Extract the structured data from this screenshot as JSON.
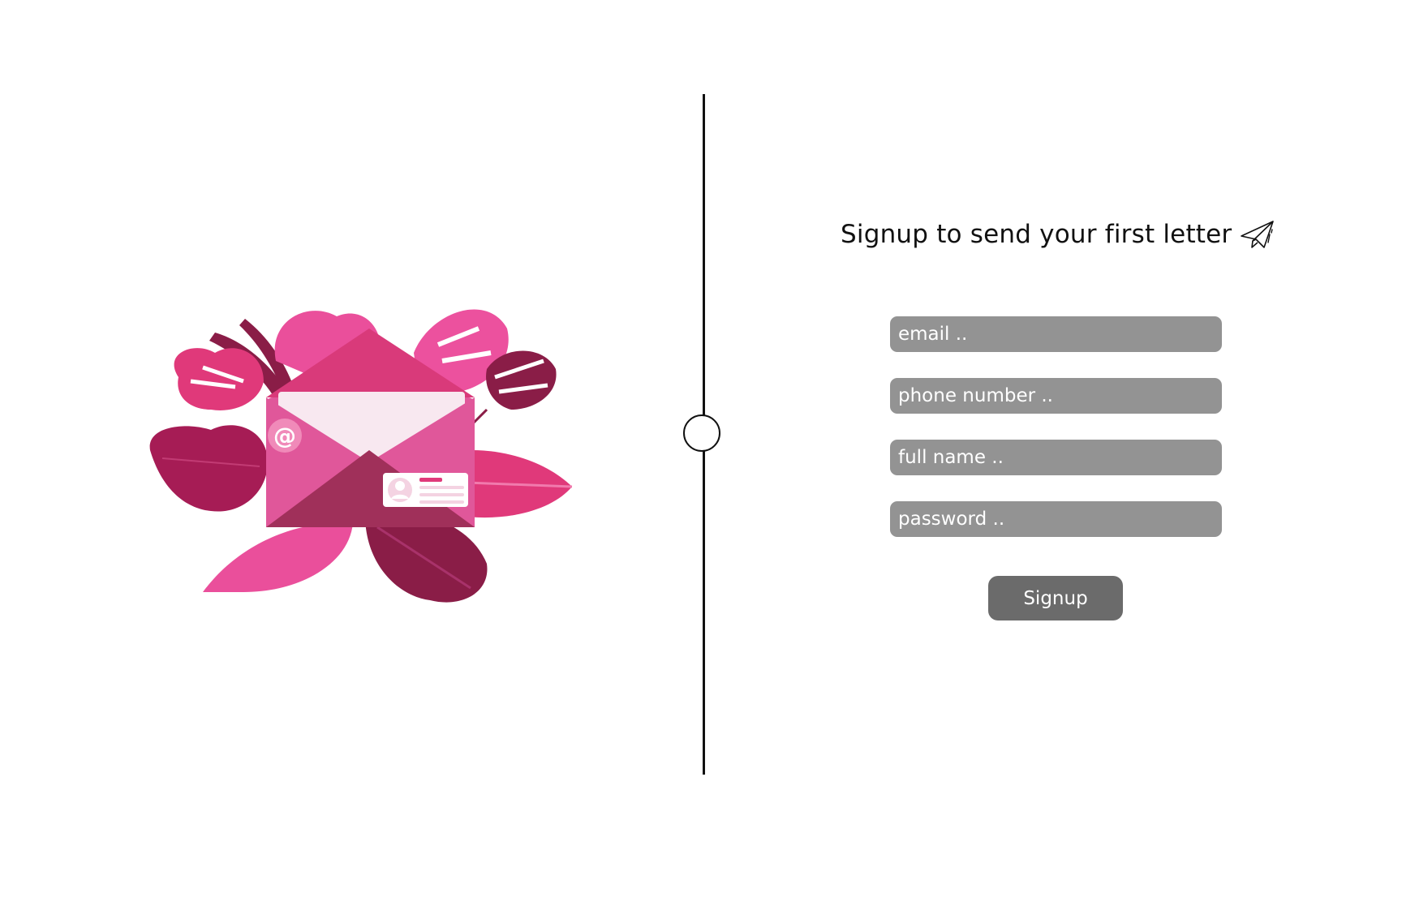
{
  "form": {
    "title": "Signup to send your first letter",
    "title_icon": "paper-plane-icon",
    "fields": {
      "email": {
        "placeholder": "email .."
      },
      "phone": {
        "placeholder": "phone number .."
      },
      "fullname": {
        "placeholder": "full name .."
      },
      "password": {
        "placeholder": "password .."
      }
    },
    "submit_label": "Signup"
  },
  "illustration": {
    "icon": "open-envelope-with-leaves-icon",
    "at_symbol": "@"
  },
  "colors": {
    "field_bg": "#939393",
    "button_bg": "#6b6b6b",
    "accent_pink": "#e0397a",
    "deep_magenta": "#8a1d47"
  }
}
